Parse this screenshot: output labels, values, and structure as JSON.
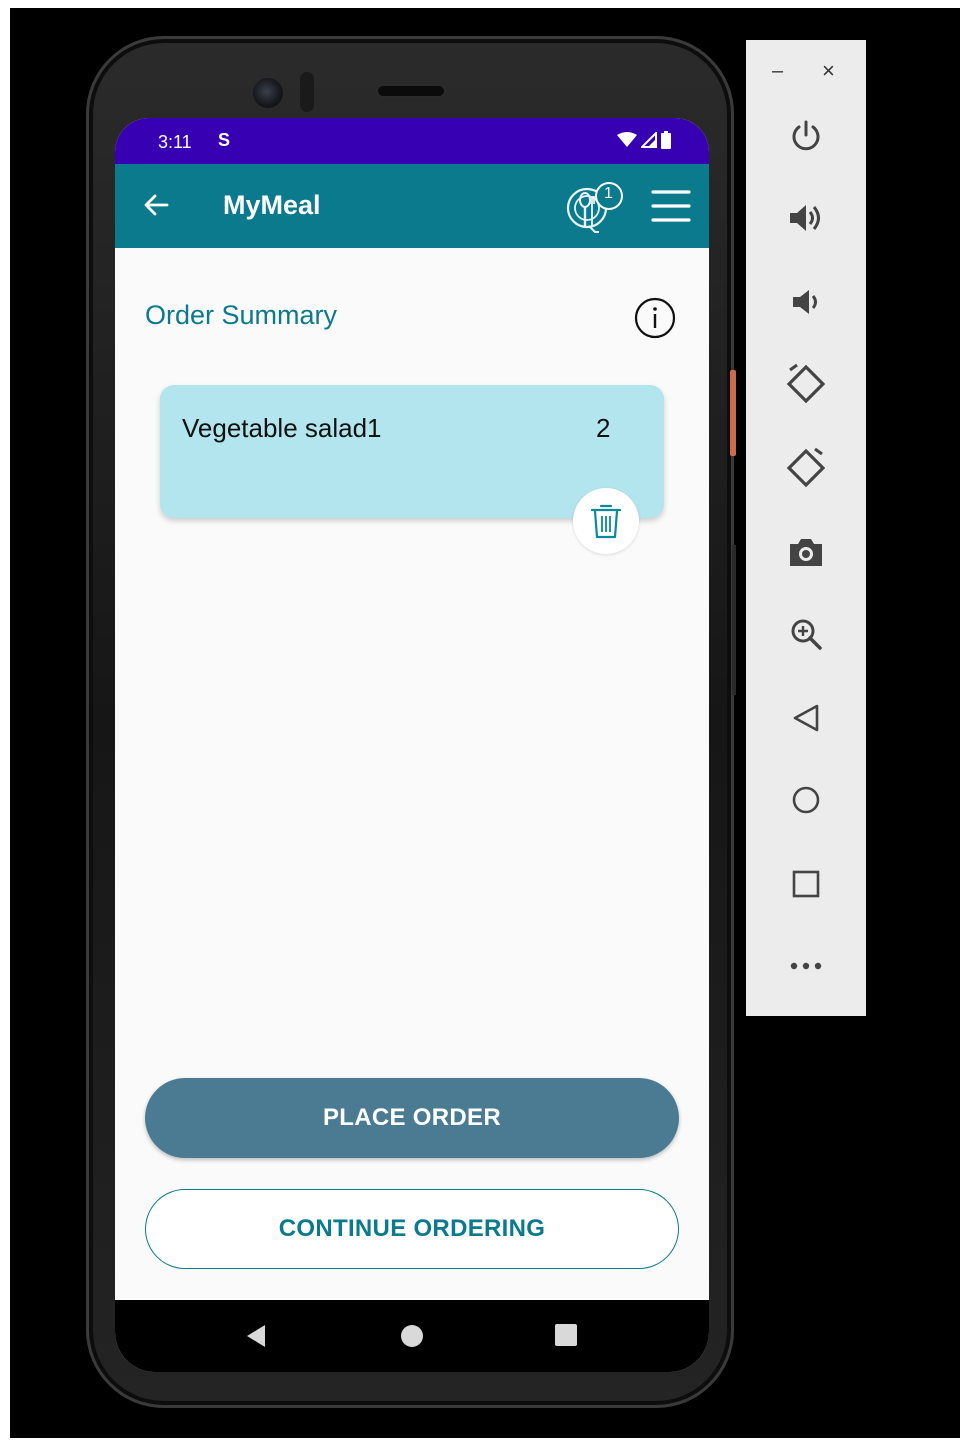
{
  "status_bar": {
    "time": "3:11",
    "indicator": "S"
  },
  "app_bar": {
    "title": "MyMeal",
    "cart_badge": "1"
  },
  "content": {
    "title": "Order Summary"
  },
  "order_items": [
    {
      "name": "Vegetable salad1",
      "quantity": "2"
    }
  ],
  "buttons": {
    "place_order": "PLACE ORDER",
    "continue_ordering": "CONTINUE ORDERING"
  },
  "emulator_panel": {
    "minimize": "–",
    "close": "×",
    "tools": [
      "power-icon",
      "volume-up-icon",
      "volume-down-icon",
      "rotate-left-icon",
      "rotate-right-icon",
      "camera-icon",
      "zoom-icon",
      "back-icon",
      "home-icon",
      "overview-icon",
      "more-icon"
    ]
  },
  "colors": {
    "status_bar": "#3800b3",
    "app_bar": "#0b7a8c",
    "card": "#b2e5ee",
    "primary_button": "#4a7b93"
  }
}
